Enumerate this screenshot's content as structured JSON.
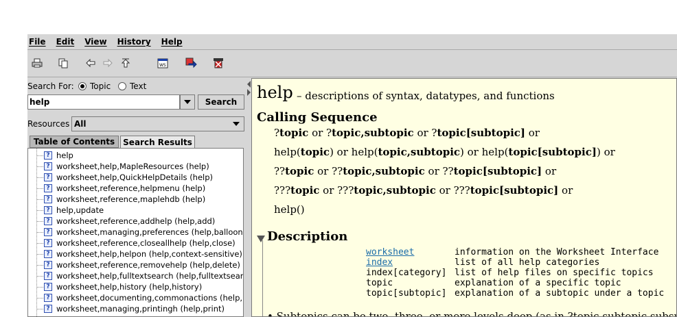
{
  "menubar": {
    "items": [
      "File",
      "Edit",
      "View",
      "History",
      "Help"
    ]
  },
  "toolbar": {
    "icons": [
      "printer-icon",
      "copy-icon",
      "back-arrow-icon",
      "forward-arrow-icon",
      "home-up-icon",
      "open-worksheet-icon",
      "go-to-page-icon",
      "close-page-icon"
    ]
  },
  "search": {
    "label": "Search For:",
    "topic_label": "Topic",
    "text_label": "Text",
    "selected": "Topic",
    "value": "help",
    "button": "Search"
  },
  "resources": {
    "label": "Resources",
    "value": "All"
  },
  "tabs": {
    "toc": "Table of Contents",
    "results": "Search Results",
    "active": "Search Results"
  },
  "results": [
    "help",
    "worksheet,help,MapleResources (help)",
    "worksheet,help,QuickHelpDetails (help)",
    "worksheet,reference,helpmenu (help)",
    "worksheet,reference,maplehdb (help)",
    "help,update",
    "worksheet,reference,addhelp (help,add)",
    "worksheet,managing,preferences (help,balloon)",
    "worksheet,reference,closeallhelp (help,close)",
    "worksheet,help,helpon (help,context-sensitive)",
    "worksheet,reference,removehelp (help,delete)",
    "worksheet,help,fulltextsearch (help,fulltextsearch)",
    "worksheet,help,history (help,history)",
    "worksheet,documenting,commonactions (help,p",
    "worksheet,managing,printingh (help,print)"
  ],
  "page": {
    "title": "help",
    "subtitle": "– descriptions of syntax, datatypes, and functions",
    "calling_heading": "Calling Sequence",
    "calling": [
      [
        [
          "?",
          false
        ],
        [
          "topic",
          true
        ],
        [
          " or ?",
          false
        ],
        [
          "topic,subtopic",
          true
        ],
        [
          " or ?",
          false
        ],
        [
          "topic[subtopic]",
          true
        ],
        [
          " or",
          false
        ]
      ],
      [
        [
          "help(",
          false
        ],
        [
          "topic",
          true
        ],
        [
          ") or help(",
          false
        ],
        [
          "topic,subtopic",
          true
        ],
        [
          ") or help(",
          false
        ],
        [
          "topic[subtopic]",
          true
        ],
        [
          ") or",
          false
        ]
      ],
      [
        [
          "??",
          false
        ],
        [
          "topic",
          true
        ],
        [
          " or ??",
          false
        ],
        [
          "topic,subtopic",
          true
        ],
        [
          " or ??",
          false
        ],
        [
          "topic[subtopic]",
          true
        ],
        [
          " or",
          false
        ]
      ],
      [
        [
          "???",
          false
        ],
        [
          "topic",
          true
        ],
        [
          " or ???",
          false
        ],
        [
          "topic,subtopic",
          true
        ],
        [
          " or ???",
          false
        ],
        [
          "topic[subtopic]",
          true
        ],
        [
          " or",
          false
        ]
      ],
      [
        [
          "help()",
          false
        ]
      ]
    ],
    "description_heading": "Description",
    "desc_table": [
      {
        "key": "worksheet",
        "link": true,
        "value": "information on the Worksheet Interface"
      },
      {
        "key": "index",
        "link": true,
        "value": "list of all help categories"
      },
      {
        "key": "index[category]",
        "link": false,
        "value": "list of help files on specific topics"
      },
      {
        "key": "topic",
        "link": false,
        "value": "explanation of a specific topic"
      },
      {
        "key": "topic[subtopic]",
        "link": false,
        "value": "explanation of a subtopic under a topic"
      }
    ],
    "bullet": "Subtopics can be two, three, or more levels deep (as in ?topic,subtopic,subsubtopic)."
  },
  "colors": {
    "page_bg": "#ffffe3",
    "link": "#1a6ba8",
    "chrome": "#d6d6d6"
  }
}
